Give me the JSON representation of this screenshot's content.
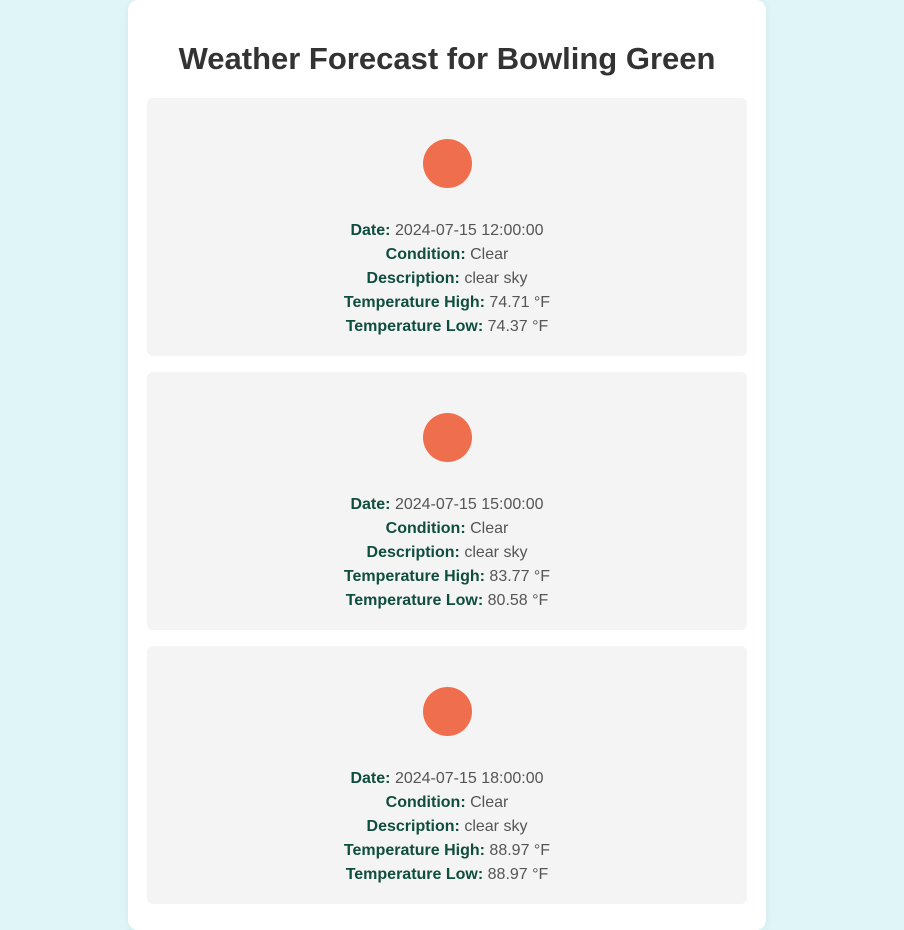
{
  "page": {
    "title": "Weather Forecast for Bowling Green"
  },
  "colors": {
    "label": "#0f4d3e",
    "value": "#555555",
    "icon": "#ee6e4d",
    "card": "#f4f4f4",
    "background": "#e0f5f8"
  },
  "labels": {
    "date": "Date:",
    "condition": "Condition:",
    "description": "Description:",
    "temp_high": "Temperature High:",
    "temp_low": "Temperature Low:"
  },
  "forecasts": [
    {
      "icon": "sun-icon",
      "date": "2024-07-15 12:00:00",
      "condition": "Clear",
      "description": "clear sky",
      "temp_high": "74.71 °F",
      "temp_low": "74.37 °F"
    },
    {
      "icon": "sun-icon",
      "date": "2024-07-15 15:00:00",
      "condition": "Clear",
      "description": "clear sky",
      "temp_high": "83.77 °F",
      "temp_low": "80.58 °F"
    },
    {
      "icon": "sun-icon",
      "date": "2024-07-15 18:00:00",
      "condition": "Clear",
      "description": "clear sky",
      "temp_high": "88.97 °F",
      "temp_low": "88.97 °F"
    }
  ]
}
